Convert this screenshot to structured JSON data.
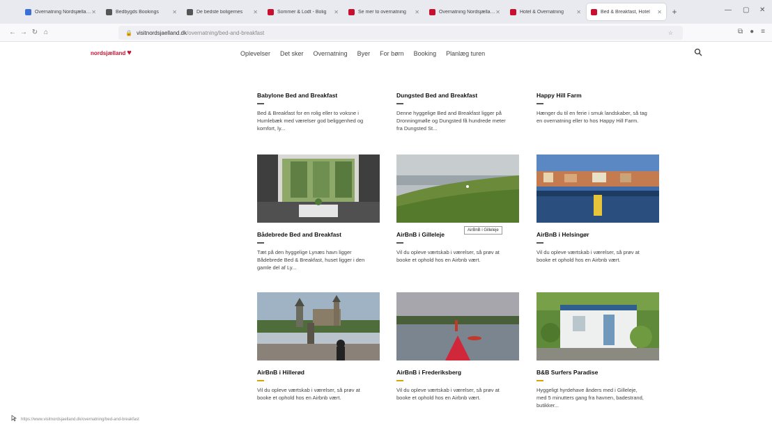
{
  "browser": {
    "tabs": [
      {
        "label": "Overnatning Nordsjælland",
        "color": "#3a6fd8",
        "active": false
      },
      {
        "label": "Bedbygds Bookings",
        "color": "#555555",
        "active": false
      },
      {
        "label": "De bedste boligernes",
        "color": "#555555",
        "active": false
      },
      {
        "label": "Sommer & Lodt - Bolig",
        "color": "#c8102e",
        "active": false
      },
      {
        "label": "Se mer to overnatning",
        "color": "#c8102e",
        "active": false
      },
      {
        "label": "Overnatning Nordsjælland",
        "color": "#c8102e",
        "active": false
      },
      {
        "label": "Hotel & Overnatning",
        "color": "#c8102e",
        "active": false
      },
      {
        "label": "Bed & Breakfast, Hotel",
        "color": "#c8102e",
        "active": true
      }
    ],
    "url_host": "visitnordsjaelland.dk",
    "url_rest": "/overnatning/bed-and-breakfast"
  },
  "site": {
    "logo": "nordsjælland",
    "nav": [
      "Oplevelser",
      "Det sker",
      "Overnatning",
      "Byer",
      "For børn",
      "Booking",
      "Planlæg turen"
    ]
  },
  "cards": [
    {
      "title": "Babylone Bed and Breakfast",
      "desc": "Bed & Breakfast for en rolig eller to voksne i Humlebæk med værelser god beliggenhed og komfort, ly...",
      "img": "field-top",
      "dash": "gray"
    },
    {
      "title": "Dungsted Bed and Breakfast",
      "desc": "Denne hyggelige Bed and Breakfast ligger på Dronningmølle og Dungsted få hundrede meter fra Dungsted St...",
      "img": "forest-top",
      "dash": "gray"
    },
    {
      "title": "Happy Hill Farm",
      "desc": "Hænger du til en ferie i smuk landskaber, så tag en overnatning eller to hos Happy Hill Farm.",
      "img": "meadow-top",
      "dash": "gray"
    },
    {
      "title": "Bådebrede Bed and Breakfast",
      "desc": "Tæt på den hyggelige Lynæs havn ligger Bådebrede Bed & Breakfast, huset ligger i den gamle del af Ly...",
      "img": "room",
      "dash": "gray"
    },
    {
      "title": "AirBnB i Gilleleje",
      "desc": "Vil du opleve værtskab i værelser, så prøv at booke et ophold hos en Airbnb vært.",
      "img": "coast",
      "dash": "gray"
    },
    {
      "title": "AirBnB i Helsingør",
      "desc": "Vil du opleve værtskab i værelser, så prøv at booke et ophold hos en Airbnb vært.",
      "img": "harbor",
      "dash": "gray"
    },
    {
      "title": "AirBnB i Hillerød",
      "desc": "Vil du opleve værtskab i værelser, så prøv at booke et ophold hos en Airbnb vært.",
      "img": "castle",
      "dash": "gold"
    },
    {
      "title": "AirBnB i Frederiksberg",
      "desc": "Vil du opleve værtskab i værelser, så prøv at booke et ophold hos en Airbnb vært.",
      "img": "kayak",
      "dash": "gold"
    },
    {
      "title": "B&B Surfers Paradise",
      "desc": "Hyggeligt hyrdehave ånders med i Gilleleje, med 5 minutters gang fra havnen, badestrand, butikker...",
      "img": "cottage",
      "dash": "gold"
    }
  ],
  "tooltip": "AirBnB i Gilleleje",
  "status": "https://www.visitnordsjaelland.dk/overnatning/bed-and-breakfast"
}
